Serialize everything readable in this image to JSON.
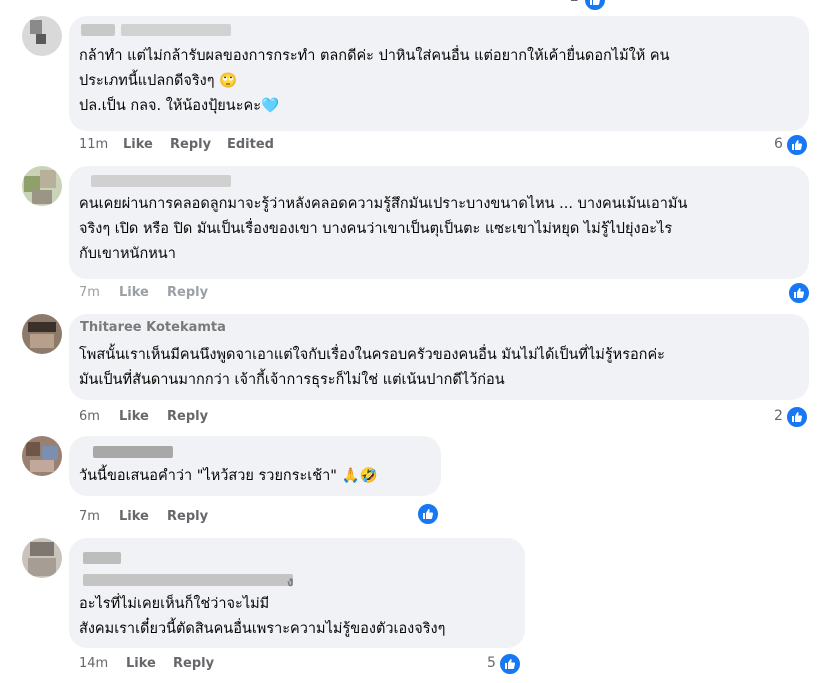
{
  "comments": [
    {
      "name_visible": "",
      "lines": [
        "กล้าทำ แต่ไม่กล้ารับผลของการกระทำ ตลกดีค่ะ ปาหินใส่คนอื่น แต่อยากให้เค้ายื่นดอกไม้ให้ คน",
        "ประเภทนี้แปลกดีจริงๆ 🙄",
        "ปล.เป็น กลจ. ให้น้องปุ้ยนะคะ🩵"
      ],
      "time": "11m",
      "like_label": "Like",
      "reply_label": "Reply",
      "edited_label": "Edited",
      "reaction_count": "6"
    },
    {
      "name_visible": "",
      "lines": [
        "คนเคยผ่านการคลอดลูกมาจะรู้ว่าหลังคลอดความรู้สึกมันเปราะบางขนาดไหน ... บางคนเม้นเอามัน",
        "จริงๆ เปิด หรือ ปิด มันเป็นเรื่องของเขา บางคนว่าเขาเป็นตุเป็นตะ แซะเขาไม่หยุด ไม่รู้ไปยุ่งอะไร",
        "กับเขาหนักหนา"
      ],
      "time": "7m",
      "like_label": "Like",
      "reply_label": "Reply",
      "reaction_count": ""
    },
    {
      "name_visible": "Thitaree Kotekamta",
      "lines": [
        "โพสนั้นเราเห็นมีคนนึงพูดจาเอาแต่ใจกับเรื่องในครอบครัวของคนอื่น มันไม่ได้เป็นที่ไม่รู้หรอกค่ะ",
        "มันเป็นที่สันดานมากกว่า เจ้ากี้เจ้าการธุระก็ไม่ใช่ แต่เน้นปากดีไว้ก่อน"
      ],
      "time": "6m",
      "like_label": "Like",
      "reply_label": "Reply",
      "reaction_count": "2"
    },
    {
      "name_visible": "",
      "lines": [
        "วันนี้ขอเสนอคำว่า \"ไหว้สวย รวยกระเช้า\" 🙏🤣"
      ],
      "time": "7m",
      "like_label": "Like",
      "reply_label": "Reply",
      "reaction_count": ""
    },
    {
      "name_visible": "ง",
      "lines": [
        "อะไรที่ไม่เคยเห็นก็ใช่ว่าจะไม่มี",
        "สังคมเราเดี๋ยวนี้ตัดสินคนอื่นเพราะความไม่รู้ของตัวเองจริงๆ"
      ],
      "time": "14m",
      "like_label": "Like",
      "reply_label": "Reply",
      "reaction_count": "5"
    }
  ],
  "top_reaction_count": "2",
  "icons": {
    "reaction": "like-thumb-icon"
  },
  "colors": {
    "bubble": "#f0f2f5",
    "like_blue": "#1877f2",
    "meta_gray": "#65676b"
  }
}
